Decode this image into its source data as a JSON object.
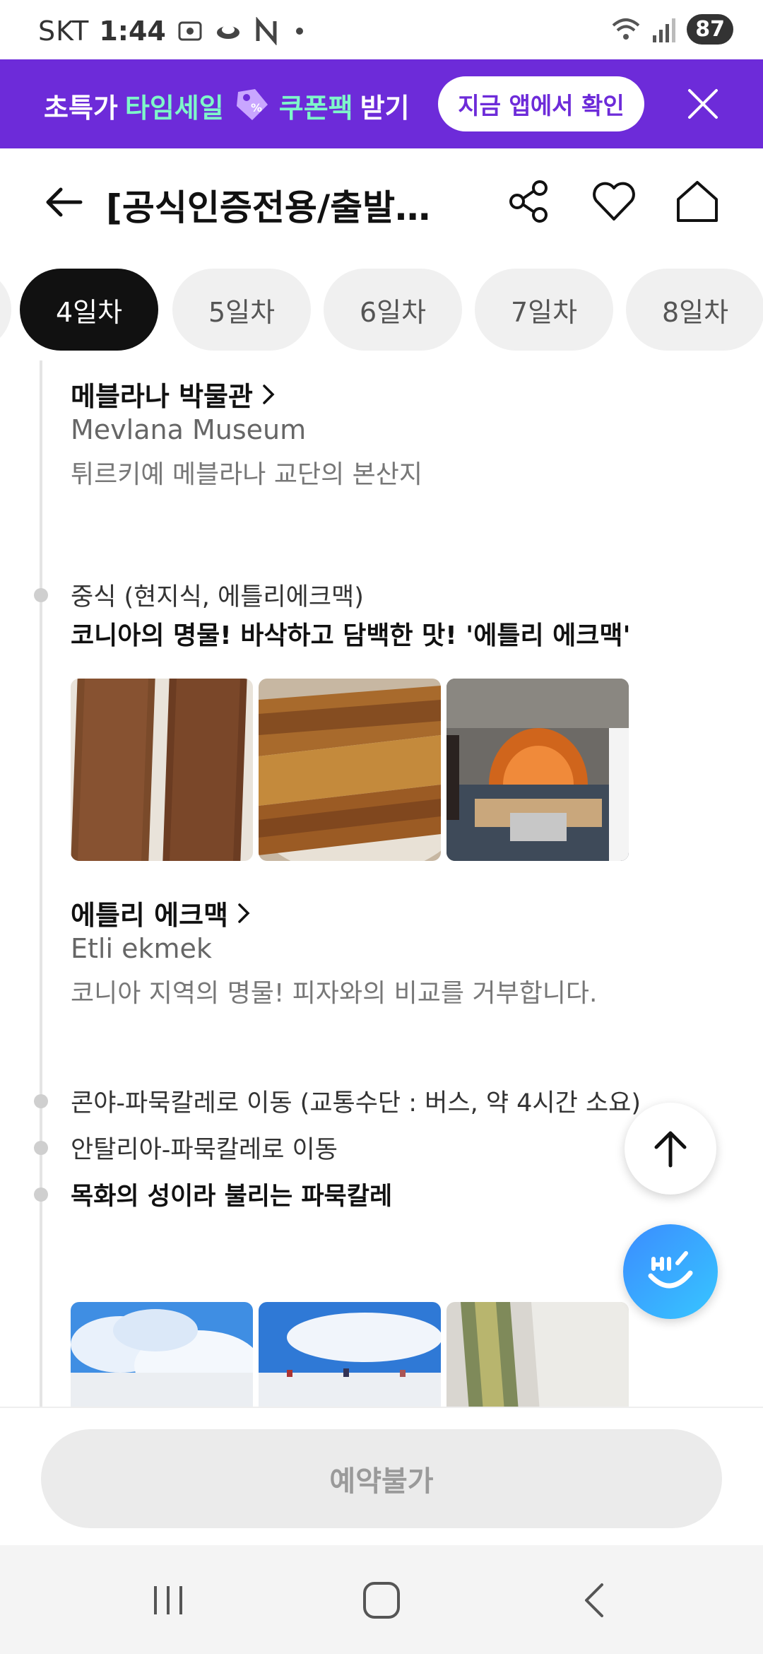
{
  "status_bar": {
    "carrier": "SKT",
    "time": "1:44",
    "battery": "87"
  },
  "promo": {
    "text_prefix": "초특가",
    "text_highlight_1": "타임세일",
    "text_highlight_2": "쿠폰팩",
    "text_suffix": "받기",
    "button_label": "지금 앱에서 확인"
  },
  "header": {
    "title": "[공식인증전용/출발확정] 튀르키예 일주"
  },
  "tabs": [
    {
      "label": "4일차",
      "active": true
    },
    {
      "label": "5일차"
    },
    {
      "label": "6일차"
    },
    {
      "label": "7일차"
    },
    {
      "label": "8일차"
    }
  ],
  "itinerary": {
    "place1": {
      "name": "메블라나 박물관",
      "name_en": "Mevlana Museum",
      "desc": "튀르키예 메블라나 교단의 본산지"
    },
    "meal": {
      "label": "중식 (현지식, 에틀리에크맥)",
      "title": "코니아의 명물! 바삭하고 담백한 맛! '에틀리 에크맥'"
    },
    "place2": {
      "name": "에틀리 에크맥",
      "name_en": "Etli ekmek",
      "desc": "코니아 지역의 명물! 피자와의 비교를 거부합니다."
    },
    "step1": "콘야-파묵칼레로 이동 (교통수단 : 버스, 약 4시간 소요)",
    "step2": "안탈리아-파묵칼레로 이동",
    "step3": "목화의 성이라 불리는 파묵칼레"
  },
  "bottom": {
    "reserve_label": "예약불가"
  },
  "colors": {
    "brand_purple": "#6d2bd9",
    "highlight_mint": "#7ef7c9",
    "hi_button": "#3b8cff"
  }
}
